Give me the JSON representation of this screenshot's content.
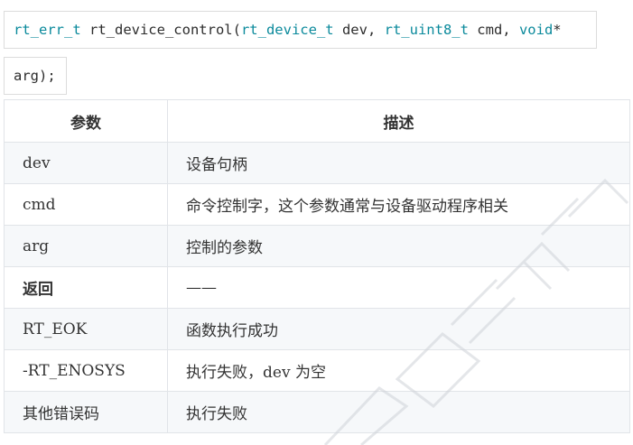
{
  "code": {
    "line1": {
      "ret_type": "rt_err_t",
      "func": " rt_device_control(",
      "arg1_type": "rt_device_t",
      "arg1_name": " dev, ",
      "arg2_type": "rt_uint8_t",
      "arg2_name": " cmd, ",
      "arg3_type": "void",
      "arg3_ptr": "*"
    },
    "line2": "arg);"
  },
  "table": {
    "headers": [
      "参数",
      "描述"
    ],
    "rows": [
      {
        "param": "dev",
        "desc": "设备句柄"
      },
      {
        "param": "cmd",
        "desc": "命令控制字，这个参数通常与设备驱动程序相关"
      },
      {
        "param": "arg",
        "desc": "控制的参数"
      },
      {
        "param": "返回",
        "desc": "——"
      },
      {
        "param": "RT_EOK",
        "desc": "函数执行成功"
      },
      {
        "param": "-RT_ENOSYS",
        "desc": "执行失败，dev 为空"
      },
      {
        "param": "其他错误码",
        "desc": "执行失败"
      }
    ]
  },
  "colors": {
    "keyword": "#0b8a9c",
    "row_shade": "#f6f8fa",
    "border": "#e1e4e8"
  }
}
